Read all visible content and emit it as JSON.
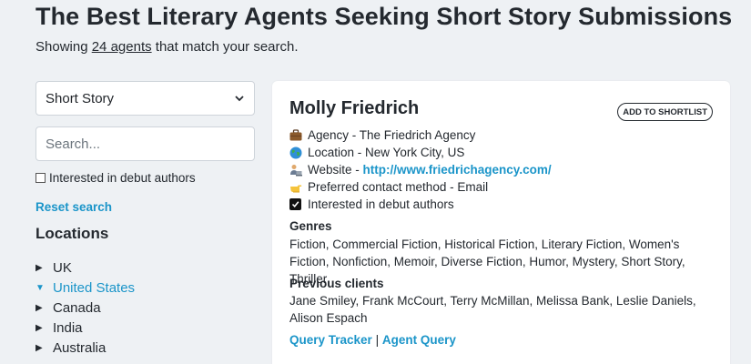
{
  "header": {
    "title": "The Best Literary Agents Seeking Short Story Submissions",
    "showing_prefix": "Showing",
    "count_link": "24 agents",
    "showing_suffix": "that match your search."
  },
  "filters": {
    "genre_selected": "Short Story",
    "search_placeholder": "Search...",
    "debut_label": "Interested in debut authors",
    "debut_checked": false,
    "reset_label": "Reset search"
  },
  "locations": {
    "title": "Locations",
    "items": [
      {
        "label": "UK",
        "expanded": false
      },
      {
        "label": "United States",
        "expanded": true
      },
      {
        "label": "Canada",
        "expanded": false
      },
      {
        "label": "India",
        "expanded": false
      },
      {
        "label": "Australia",
        "expanded": false
      }
    ]
  },
  "agent": {
    "name": "Molly Friedrich",
    "shortlist_label": "ADD TO SHORTLIST",
    "agency": "Agency - The Friedrich Agency",
    "location": "Location - New York City, US",
    "website_prefix": "Website -",
    "website_url": "http://www.friedrichagency.com/",
    "contact": "Preferred contact method - Email",
    "debut": "Interested in debut authors",
    "genres_title": "Genres",
    "genres": "Fiction, Commercial Fiction, Historical Fiction, Literary Fiction, Women's Fiction, Nonfiction, Memoir, Diverse Fiction, Humor, Mystery, Short Story, Thriller",
    "clients_title": "Previous clients",
    "clients": "Jane Smiley, Frank McCourt, Terry McMillan, Melissa Bank, Leslie Daniels, Alison Espach",
    "query_tracker": "Query Tracker",
    "separator": "|",
    "agent_query": "Agent Query"
  },
  "colors": {
    "accent": "#1b95c9",
    "background": "#eef1f4",
    "card": "#ffffff",
    "text": "#24292f"
  },
  "icons": {
    "agency": "briefcase-icon",
    "location": "globe-icon",
    "website": "person-at-computer-icon",
    "contact": "pointing-hand-icon",
    "debut": "checkbox-checked-icon",
    "select": "chevron-down-icon",
    "location_collapsed": "triangle-right-icon",
    "location_expanded": "triangle-down-icon"
  }
}
